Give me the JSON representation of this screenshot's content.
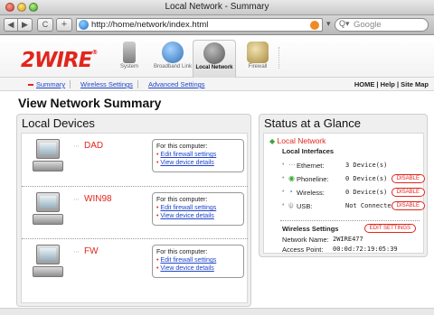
{
  "window": {
    "title": "Local Network - Summary"
  },
  "browser": {
    "url": "http://home/network/index.html",
    "search_placeholder": "Google",
    "back_label": "◀",
    "forward_label": "▶",
    "reload_label": "C",
    "add_label": "+"
  },
  "header": {
    "logo": "2WIRE",
    "tabs": [
      {
        "label": "System",
        "icon": "system-icon"
      },
      {
        "label": "Broadband Link",
        "icon": "broadband-icon"
      },
      {
        "label": "Local Network",
        "icon": "local-network-icon",
        "active": true
      },
      {
        "label": "Firewall",
        "icon": "firewall-icon"
      }
    ]
  },
  "subnav": {
    "links": [
      "Summary",
      "Wireless Settings",
      "Advanced Settings"
    ],
    "utility": [
      "HOME",
      "Help",
      "Site Map"
    ]
  },
  "page": {
    "title": "View Network Summary"
  },
  "devices": {
    "title": "Local Devices",
    "items": [
      {
        "name": "DAD",
        "box_head": "For this computer:",
        "link1": "Edit firewall settings",
        "link2": "View device details"
      },
      {
        "name": "WIN98",
        "box_head": "For this computer:",
        "link1": "Edit firewall settings",
        "link2": "View device details"
      },
      {
        "name": "FW",
        "box_head": "For this computer:",
        "link1": "Edit firewall settings",
        "link2": "View device details"
      }
    ]
  },
  "status": {
    "title": "Status at a Glance",
    "network_label": "Local Network",
    "interfaces_label": "Local Interfaces",
    "interfaces": [
      {
        "name": "Ethernet:",
        "value": "3 Device(s)",
        "has_disable": false
      },
      {
        "name": "Phoneline:",
        "value": "0 Device(s)",
        "has_disable": true
      },
      {
        "name": "Wireless:",
        "value": "0 Device(s)",
        "has_disable": true
      },
      {
        "name": "USB:",
        "value": "Not Connected",
        "has_disable": true
      }
    ],
    "disable_label": "DISABLE",
    "wireless_label": "Wireless Settings",
    "edit_label": "EDIT SETTINGS",
    "network_name_label": "Network Name:",
    "network_name": "2WIRE477",
    "access_point_label": "Access Point:",
    "access_point": "00:0d:72:19:05:39"
  },
  "colors": {
    "accent": "#e1261c",
    "link": "#1f45c8"
  }
}
